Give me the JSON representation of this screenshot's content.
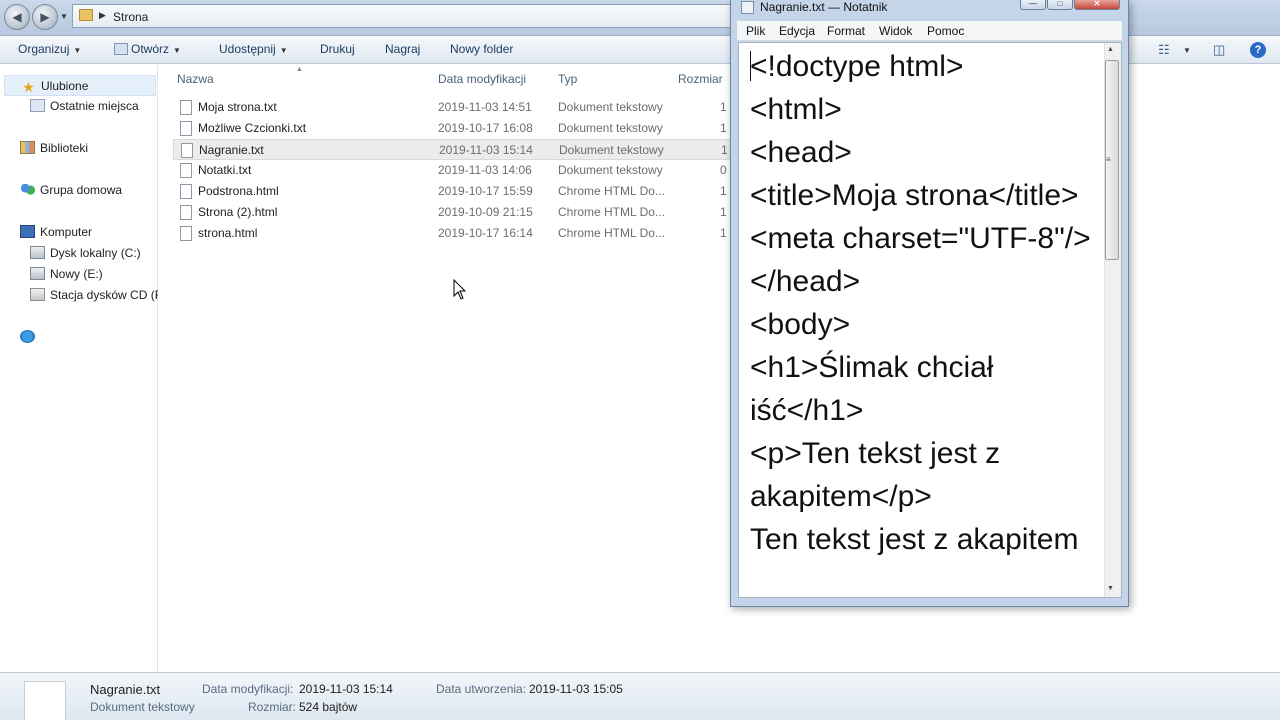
{
  "explorer": {
    "address": "Strona",
    "toolbar": {
      "organize": "Organizuj",
      "open": "Otwórz",
      "share": "Udostępnij",
      "print": "Drukuj",
      "burn": "Nagraj",
      "new_folder": "Nowy folder"
    },
    "nav": {
      "favorites": "Ulubione",
      "recent": "Ostatnie miejsca",
      "libraries": "Biblioteki",
      "homegroup": "Grupa domowa",
      "computer": "Komputer",
      "local_disk": "Dysk lokalny (C:)",
      "new_drive": "Nowy (E:)",
      "cd_drive": "Stacja dysków CD (F"
    },
    "columns": {
      "name": "Nazwa",
      "modified": "Data modyfikacji",
      "type": "Typ",
      "size": "Rozmiar"
    },
    "files": [
      {
        "name": "Moja strona.txt",
        "modified": "2019-11-03 14:51",
        "type": "Dokument tekstowy",
        "size": "1"
      },
      {
        "name": "Możliwe Czcionki.txt",
        "modified": "2019-10-17 16:08",
        "type": "Dokument tekstowy",
        "size": "1"
      },
      {
        "name": "Nagranie.txt",
        "modified": "2019-11-03 15:14",
        "type": "Dokument tekstowy",
        "size": "1"
      },
      {
        "name": "Notatki.txt",
        "modified": "2019-11-03 14:06",
        "type": "Dokument tekstowy",
        "size": "0"
      },
      {
        "name": "Podstrona.html",
        "modified": "2019-10-17 15:59",
        "type": "Chrome HTML Do...",
        "size": "1"
      },
      {
        "name": "Strona (2).html",
        "modified": "2019-10-09 21:15",
        "type": "Chrome HTML Do...",
        "size": "1"
      },
      {
        "name": "strona.html",
        "modified": "2019-10-17 16:14",
        "type": "Chrome HTML Do...",
        "size": "1"
      }
    ],
    "details": {
      "filename": "Nagranie.txt",
      "filetype": "Dokument tekstowy",
      "modified_label": "Data modyfikacji:",
      "modified_value": "2019-11-03 15:14",
      "created_label": "Data utworzenia:",
      "created_value": "2019-11-03 15:05",
      "size_label": "Rozmiar:",
      "size_value": "524 bajtów"
    }
  },
  "notepad": {
    "title": "Nagranie.txt — Notatnik",
    "menu": [
      "Plik",
      "Edycja",
      "Format",
      "Widok",
      "Pomoc"
    ],
    "lines": [
      "<!doctype html>",
      "<html>",
      "<head>",
      "<title>Moja strona</title>",
      "<meta charset=\"UTF-8\"/>",
      "</head>",
      "<body>",
      "<h1>Ślimak chciał",
      "iść</h1>",
      "<p>Ten tekst jest z",
      "akapitem</p>",
      "Ten tekst jest z akapitem"
    ]
  },
  "colors": {
    "selection": "#ececec",
    "toolbar_text": "#1e3a5f",
    "accent": "#2a6ac4"
  }
}
